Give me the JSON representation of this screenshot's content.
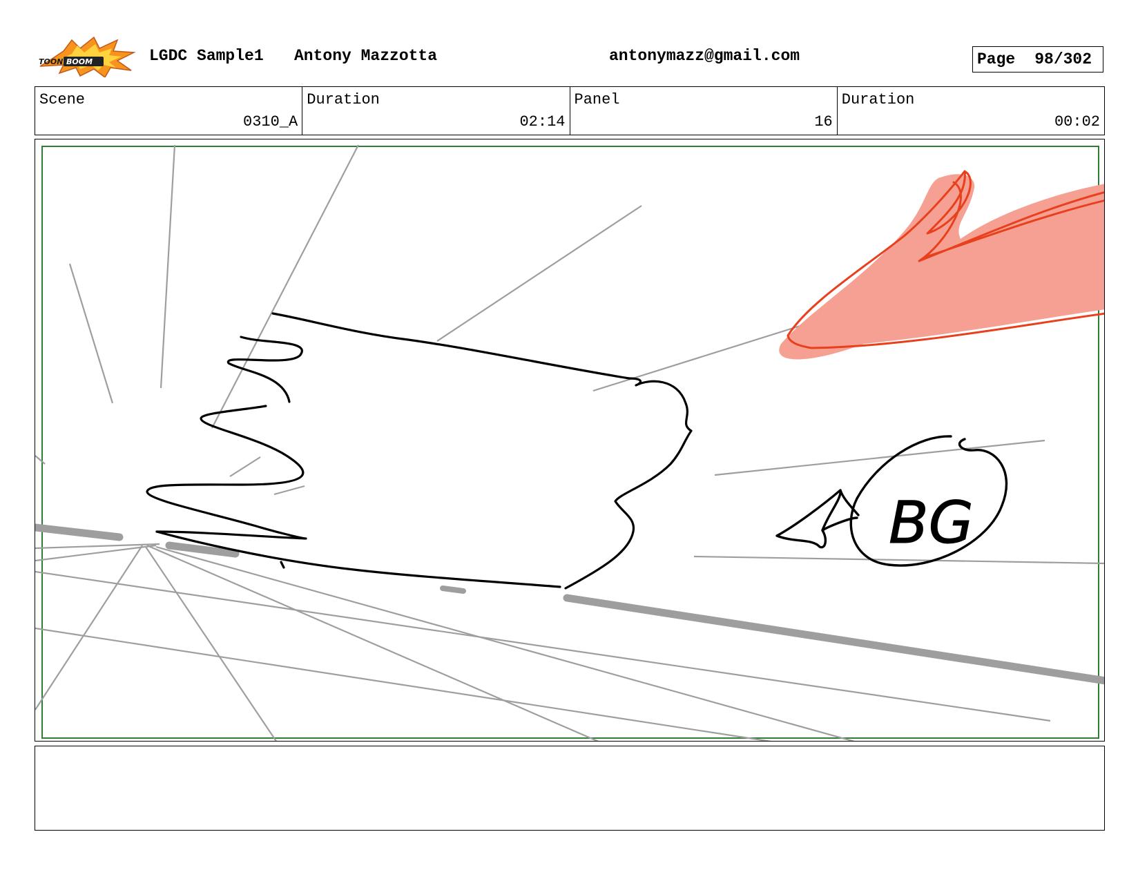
{
  "header": {
    "logo_text": "TOONBOOM",
    "project": "LGDC Sample1",
    "author": "Antony Mazzotta",
    "email": "antonymazz@gmail.com",
    "page_label": "Page",
    "page_value": "98/302"
  },
  "info": {
    "scene_label": "Scene",
    "scene_value": "0310_A",
    "scene_duration_label": "Duration",
    "scene_duration_value": "02:14",
    "panel_label": "Panel",
    "panel_value": "16",
    "panel_duration_label": "Duration",
    "panel_duration_value": "00:02"
  },
  "sketch": {
    "annotation_text": "BG",
    "colors": {
      "safe_frame": "#2e7d32",
      "speed_lines": "#9e9e9e",
      "ink": "#000000",
      "red_stroke": "#e8401c",
      "red_fill": "#f5a093"
    }
  },
  "notes": {
    "text": ""
  }
}
